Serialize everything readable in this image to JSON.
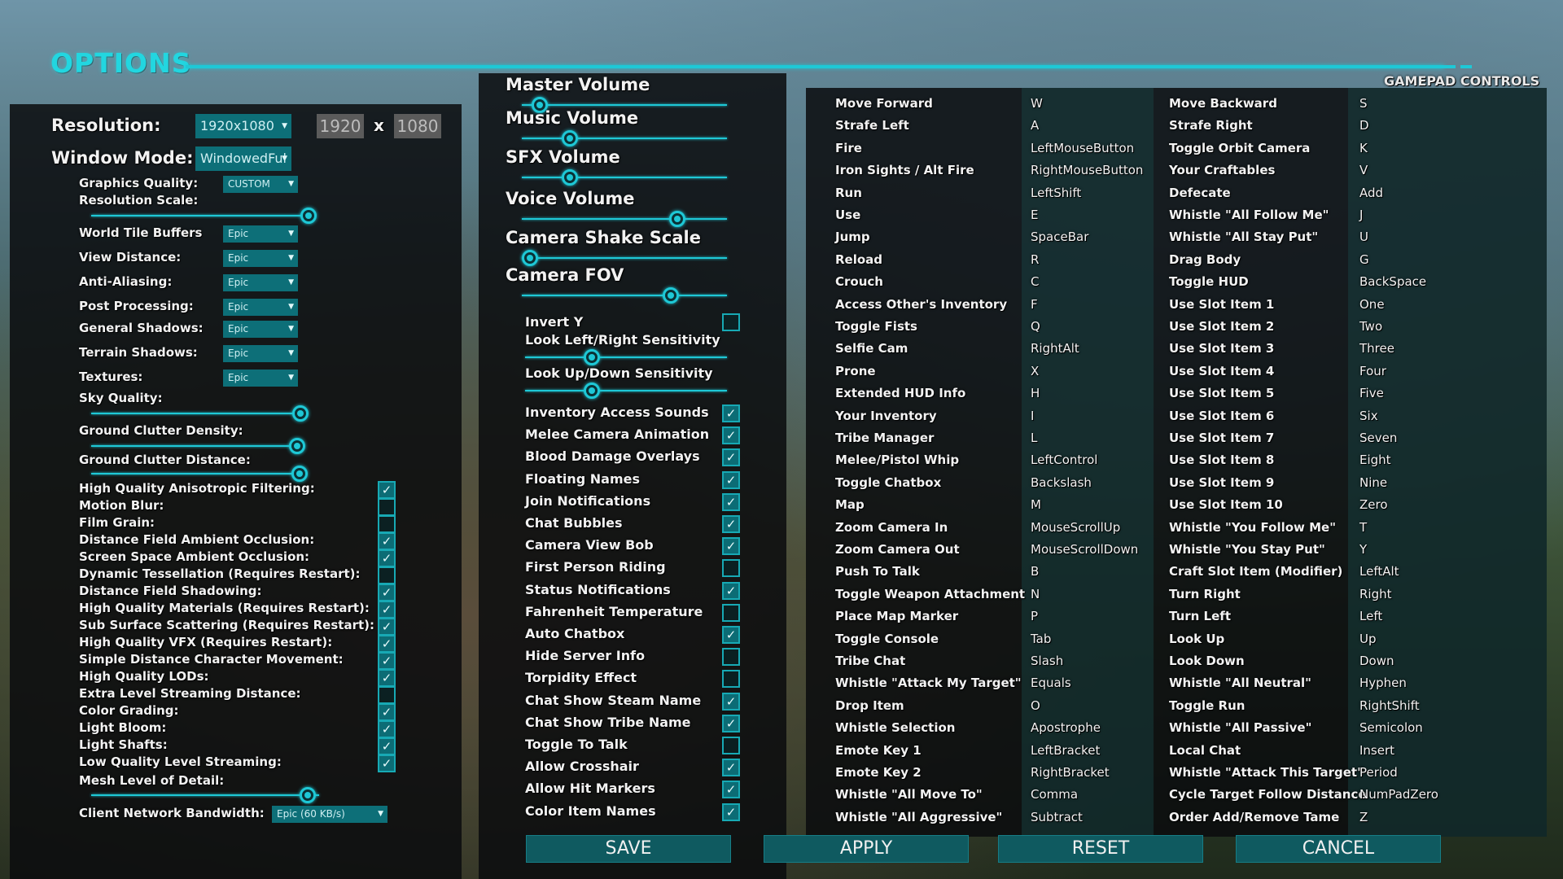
{
  "header": {
    "title": "OPTIONS",
    "gamepad_controls": "GAMEPAD CONTROLS"
  },
  "left": {
    "resolution_label": "Resolution:",
    "resolution_value": "1920x1080",
    "res_width": "1920",
    "res_x": "x",
    "res_height": "1080",
    "window_mode_label": "Window Mode:",
    "window_mode_value": "WindowedFul",
    "graphics_quality_label": "Graphics Quality:",
    "graphics_quality_value": "CUSTOM",
    "resolution_scale_label": "Resolution Scale:",
    "quality_rows": [
      {
        "label": "World Tile Buffers",
        "value": "Epic"
      },
      {
        "label": "View Distance:",
        "value": "Epic"
      },
      {
        "label": "Anti-Aliasing:",
        "value": "Epic"
      },
      {
        "label": "Post Processing:",
        "value": "Epic"
      },
      {
        "label": "General Shadows:",
        "value": "Epic"
      },
      {
        "label": "Terrain Shadows:",
        "value": "Epic"
      },
      {
        "label": "Textures:",
        "value": "Epic"
      }
    ],
    "sky_quality_label": "Sky Quality:",
    "ground_clutter_density_label": "Ground Clutter Density:",
    "ground_clutter_distance_label": "Ground Clutter Distance:",
    "checks": [
      {
        "label": "High Quality Anisotropic Filtering:",
        "checked": true
      },
      {
        "label": "Motion Blur:",
        "checked": false
      },
      {
        "label": "Film Grain:",
        "checked": false
      },
      {
        "label": "Distance Field Ambient Occlusion:",
        "checked": true
      },
      {
        "label": "Screen Space Ambient Occlusion:",
        "checked": true
      },
      {
        "label": "Dynamic Tessellation (Requires Restart):",
        "checked": false
      },
      {
        "label": "Distance Field Shadowing:",
        "checked": true
      },
      {
        "label": "High Quality Materials (Requires Restart):",
        "checked": true
      },
      {
        "label": "Sub Surface Scattering (Requires Restart):",
        "checked": true
      },
      {
        "label": "High Quality VFX (Requires Restart):",
        "checked": true
      },
      {
        "label": "Simple Distance Character Movement:",
        "checked": true
      },
      {
        "label": "High Quality LODs:",
        "checked": true
      },
      {
        "label": "Extra Level Streaming Distance:",
        "checked": false
      },
      {
        "label": "Color Grading:",
        "checked": true
      },
      {
        "label": "Light Bloom:",
        "checked": true
      },
      {
        "label": "Light Shafts:",
        "checked": true
      },
      {
        "label": "Low Quality Level Streaming:",
        "checked": true
      }
    ],
    "mesh_lod_label": "Mesh Level of Detail:",
    "bandwidth_label": "Client Network Bandwidth:",
    "bandwidth_value": "Epic (60 KB/s)"
  },
  "middle": {
    "volumes": [
      {
        "label": "Master Volume",
        "level": 0.05
      },
      {
        "label": "Music Volume",
        "level": 0.2
      },
      {
        "label": "SFX Volume",
        "level": 0.2
      },
      {
        "label": "Voice Volume",
        "level": 0.74
      },
      {
        "label": "Camera Shake Scale",
        "level": 0.0
      },
      {
        "label": "Camera FOV",
        "level": 0.71
      }
    ],
    "invert_y": {
      "label": "Invert Y",
      "checked": false
    },
    "sensitivity": [
      {
        "label": "Look Left/Right Sensitivity",
        "level": 0.3
      },
      {
        "label": "Look Up/Down Sensitivity",
        "level": 0.3
      }
    ],
    "checks": [
      {
        "label": "Inventory Access Sounds",
        "checked": true
      },
      {
        "label": "Melee Camera Animation",
        "checked": true
      },
      {
        "label": "Blood Damage Overlays",
        "checked": true
      },
      {
        "label": "Floating Names",
        "checked": true
      },
      {
        "label": "Join Notifications",
        "checked": true
      },
      {
        "label": "Chat Bubbles",
        "checked": true
      },
      {
        "label": "Camera View Bob",
        "checked": true
      },
      {
        "label": "First Person Riding",
        "checked": false
      },
      {
        "label": "Status Notifications",
        "checked": true
      },
      {
        "label": "Fahrenheit Temperature",
        "checked": false
      },
      {
        "label": "Auto Chatbox",
        "checked": true
      },
      {
        "label": "Hide Server Info",
        "checked": false
      },
      {
        "label": "Torpidity Effect",
        "checked": false
      },
      {
        "label": "Chat Show Steam Name",
        "checked": true
      },
      {
        "label": "Chat Show Tribe Name",
        "checked": true
      },
      {
        "label": "Toggle To Talk",
        "checked": false
      },
      {
        "label": "Allow Crosshair",
        "checked": true
      },
      {
        "label": "Allow Hit Markers",
        "checked": true
      },
      {
        "label": "Color Item Names",
        "checked": true
      }
    ]
  },
  "keybinds": {
    "col1": [
      {
        "action": "Move Forward",
        "key": "W"
      },
      {
        "action": "Strafe Left",
        "key": "A"
      },
      {
        "action": "Fire",
        "key": "LeftMouseButton"
      },
      {
        "action": "Iron Sights / Alt Fire",
        "key": "RightMouseButton"
      },
      {
        "action": "Run",
        "key": "LeftShift"
      },
      {
        "action": "Use",
        "key": "E"
      },
      {
        "action": "Jump",
        "key": "SpaceBar"
      },
      {
        "action": "Reload",
        "key": "R"
      },
      {
        "action": "Crouch",
        "key": "C"
      },
      {
        "action": "Access Other's Inventory",
        "key": "F"
      },
      {
        "action": "Toggle Fists",
        "key": "Q"
      },
      {
        "action": "Selfie Cam",
        "key": "RightAlt"
      },
      {
        "action": "Prone",
        "key": "X"
      },
      {
        "action": "Extended HUD Info",
        "key": "H"
      },
      {
        "action": "Your Inventory",
        "key": "I"
      },
      {
        "action": "Tribe Manager",
        "key": "L"
      },
      {
        "action": "Melee/Pistol Whip",
        "key": "LeftControl"
      },
      {
        "action": "Toggle Chatbox",
        "key": "Backslash"
      },
      {
        "action": "Map",
        "key": "M"
      },
      {
        "action": "Zoom Camera In",
        "key": "MouseScrollUp"
      },
      {
        "action": "Zoom Camera Out",
        "key": "MouseScrollDown"
      },
      {
        "action": "Push To Talk",
        "key": "B"
      },
      {
        "action": "Toggle Weapon Attachment",
        "key": "N"
      },
      {
        "action": "Place Map Marker",
        "key": "P"
      },
      {
        "action": "Toggle Console",
        "key": "Tab"
      },
      {
        "action": "Tribe Chat",
        "key": "Slash"
      },
      {
        "action": "Whistle \"Attack My Target\"",
        "key": "Equals"
      },
      {
        "action": "Drop Item",
        "key": "O"
      },
      {
        "action": "Whistle Selection",
        "key": "Apostrophe"
      },
      {
        "action": "Emote Key 1",
        "key": "LeftBracket"
      },
      {
        "action": "Emote Key 2",
        "key": "RightBracket"
      },
      {
        "action": "Whistle \"All Move To\"",
        "key": "Comma"
      },
      {
        "action": "Whistle \"All Aggressive\"",
        "key": "Subtract"
      }
    ],
    "col2": [
      {
        "action": "Move Backward",
        "key": "S"
      },
      {
        "action": "Strafe Right",
        "key": "D"
      },
      {
        "action": "Toggle Orbit Camera",
        "key": "K"
      },
      {
        "action": "Your Craftables",
        "key": "V"
      },
      {
        "action": "Defecate",
        "key": "Add"
      },
      {
        "action": "Whistle \"All Follow Me\"",
        "key": "J"
      },
      {
        "action": "Whistle \"All Stay Put\"",
        "key": "U"
      },
      {
        "action": "Drag Body",
        "key": "G"
      },
      {
        "action": "Toggle HUD",
        "key": "BackSpace"
      },
      {
        "action": "Use Slot Item 1",
        "key": "One"
      },
      {
        "action": "Use Slot Item 2",
        "key": "Two"
      },
      {
        "action": "Use Slot Item 3",
        "key": "Three"
      },
      {
        "action": "Use Slot Item 4",
        "key": "Four"
      },
      {
        "action": "Use Slot Item 5",
        "key": "Five"
      },
      {
        "action": "Use Slot Item 6",
        "key": "Six"
      },
      {
        "action": "Use Slot Item 7",
        "key": "Seven"
      },
      {
        "action": "Use Slot Item 8",
        "key": "Eight"
      },
      {
        "action": "Use Slot Item 9",
        "key": "Nine"
      },
      {
        "action": "Use Slot Item 10",
        "key": "Zero"
      },
      {
        "action": "Whistle \"You Follow Me\"",
        "key": "T"
      },
      {
        "action": "Whistle \"You Stay Put\"",
        "key": "Y"
      },
      {
        "action": "Craft Slot Item (Modifier)",
        "key": "LeftAlt"
      },
      {
        "action": "Turn Right",
        "key": "Right"
      },
      {
        "action": "Turn Left",
        "key": "Left"
      },
      {
        "action": "Look Up",
        "key": "Up"
      },
      {
        "action": "Look Down",
        "key": "Down"
      },
      {
        "action": "Whistle \"All Neutral\"",
        "key": "Hyphen"
      },
      {
        "action": "Toggle Run",
        "key": "RightShift"
      },
      {
        "action": "Whistle \"All Passive\"",
        "key": "Semicolon"
      },
      {
        "action": "Local Chat",
        "key": "Insert"
      },
      {
        "action": "Whistle \"Attack This Target\"",
        "key": "Period"
      },
      {
        "action": "Cycle Target Follow Distance",
        "key": "NumPadZero"
      },
      {
        "action": "Order Add/Remove Tame",
        "key": "Z"
      }
    ]
  },
  "buttons": {
    "save": "SAVE",
    "apply": "APPLY",
    "reset": "RESET",
    "cancel": "CANCEL"
  },
  "colors": {
    "accent": "#1ec8d6",
    "panel": "#0a0c0e",
    "button": "#0f5a60"
  }
}
